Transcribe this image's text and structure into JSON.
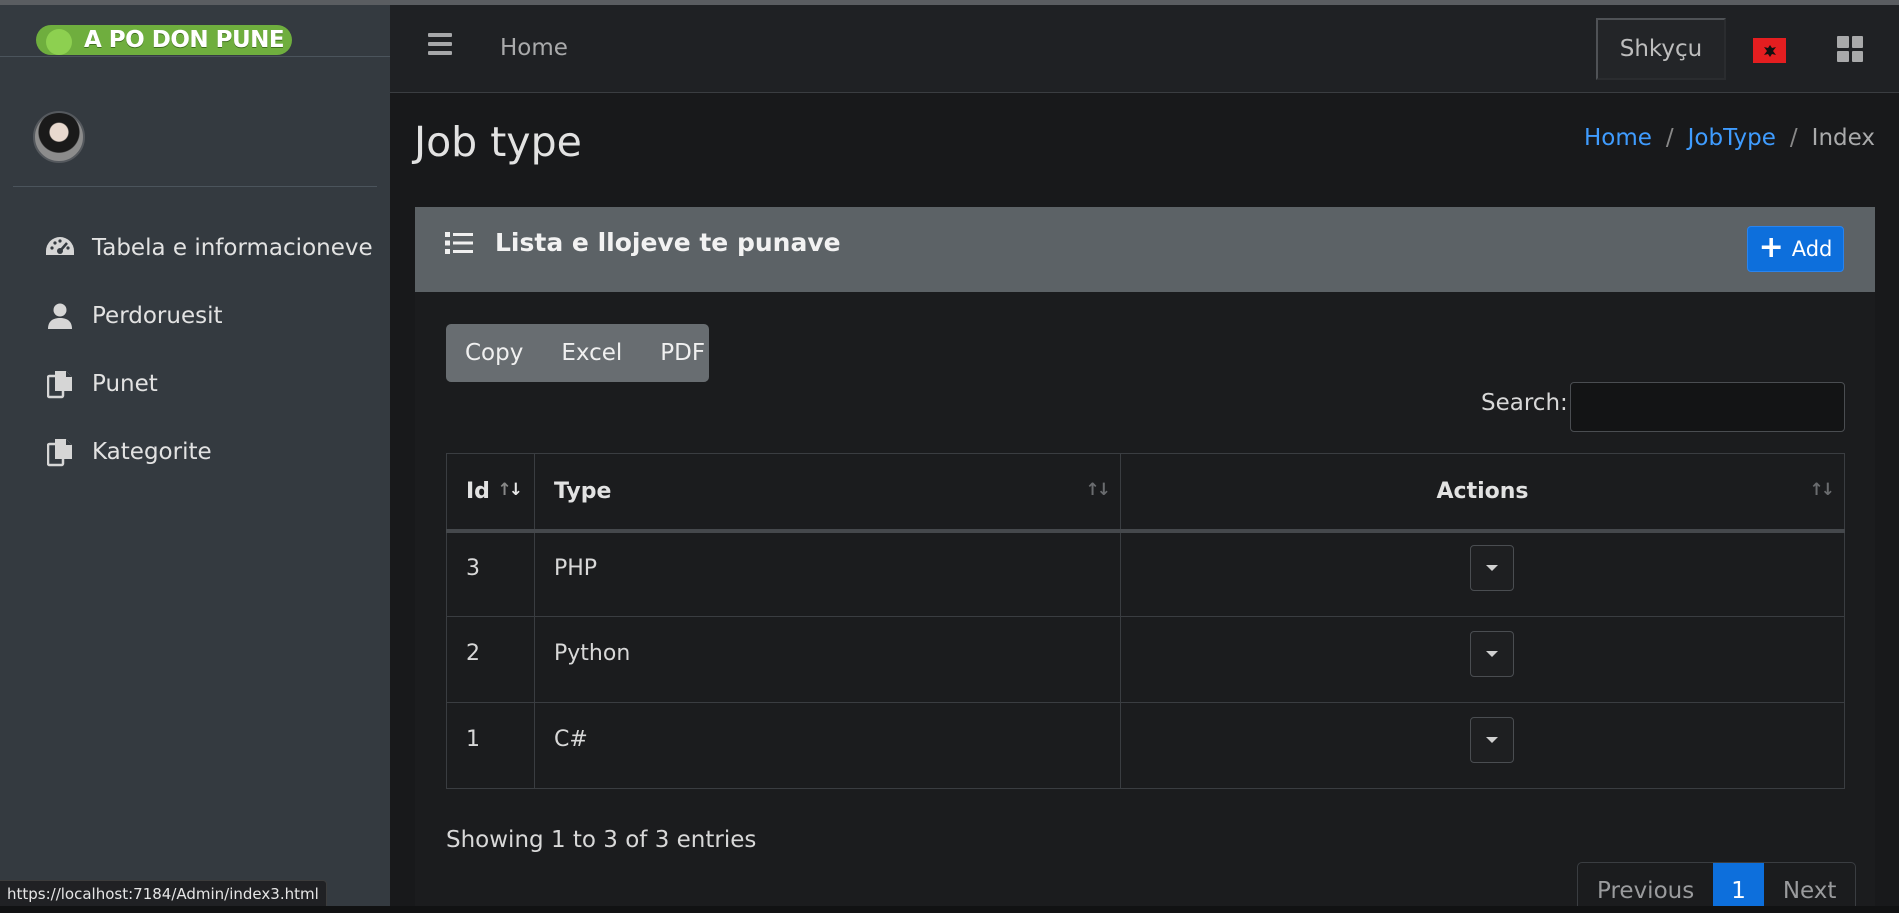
{
  "sidebar": {
    "brand": "A PO DON PUNE",
    "items": [
      {
        "label": "Tabela e informacioneve",
        "icon": "dashboard-gauge-icon"
      },
      {
        "label": "Perdoruesit",
        "icon": "user-icon"
      },
      {
        "label": "Punet",
        "icon": "copy-files-icon"
      },
      {
        "label": "Kategorite",
        "icon": "copy-files-icon"
      }
    ]
  },
  "navbar": {
    "home_label": "Home",
    "login_label": "Shkyçu"
  },
  "page": {
    "title": "Job type",
    "breadcrumb": {
      "home": "Home",
      "sep": "/",
      "section": "JobType",
      "current": "Index"
    }
  },
  "card": {
    "title": "Lista e llojeve te punave",
    "add_label": "Add"
  },
  "export_buttons": {
    "copy": "Copy",
    "excel": "Excel",
    "pdf": "PDF"
  },
  "search": {
    "label": "Search:",
    "value": ""
  },
  "table": {
    "columns": {
      "id": "Id",
      "type": "Type",
      "actions": "Actions"
    },
    "rows": [
      {
        "id": "3",
        "type": "PHP"
      },
      {
        "id": "2",
        "type": "Python"
      },
      {
        "id": "1",
        "type": "C#"
      }
    ]
  },
  "footer": {
    "info": "Showing 1 to 3 of 3 entries"
  },
  "pagination": {
    "previous": "Previous",
    "current": "1",
    "next": "Next"
  },
  "status_bar": {
    "url": "https://localhost:7184/Admin/index3.html"
  },
  "colors": {
    "accent": "#0d6fdc",
    "link": "#3f9cff",
    "sidebar": "#343a40",
    "card_header": "#5c6266"
  }
}
